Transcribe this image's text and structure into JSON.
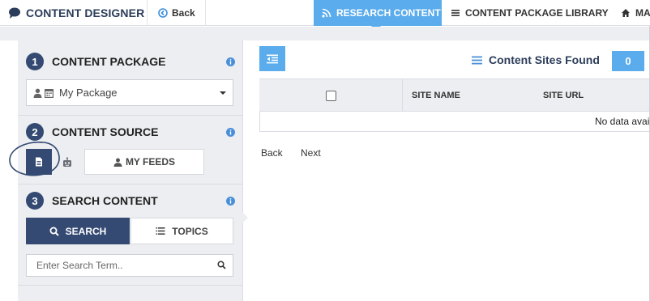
{
  "header": {
    "app_title": "CONTENT DESIGNER",
    "back_label": "Back",
    "tabs": [
      {
        "label": "RESEARCH CONTENT",
        "active": true,
        "icon": "rss-icon"
      },
      {
        "label": "CONTENT PACKAGE LIBRARY",
        "active": false,
        "icon": "list-icon"
      },
      {
        "label": "MA",
        "active": false,
        "icon": "home-icon"
      }
    ]
  },
  "sidebar": {
    "content_package": {
      "number": "1",
      "title": "CONTENT PACKAGE",
      "selected_value": "My Package"
    },
    "content_source": {
      "number": "2",
      "title": "CONTENT SOURCE",
      "my_feeds_label": "MY FEEDS"
    },
    "search_content": {
      "number": "3",
      "title": "SEARCH CONTENT",
      "search_label": "SEARCH",
      "topics_label": "TOPICS",
      "input_placeholder": "Enter Search Term.."
    }
  },
  "main": {
    "found_label": "Content Sites Found",
    "found_count": "0",
    "table": {
      "columns": [
        "SITE NAME",
        "SITE URL"
      ],
      "empty_text": "No data available"
    },
    "pager": {
      "back_label": "Back",
      "next_label": "Next"
    }
  },
  "colors": {
    "accent_blue": "#5aacec",
    "navy": "#344a73",
    "panel_gray": "#eceef1",
    "info_blue": "#4a90d9"
  }
}
